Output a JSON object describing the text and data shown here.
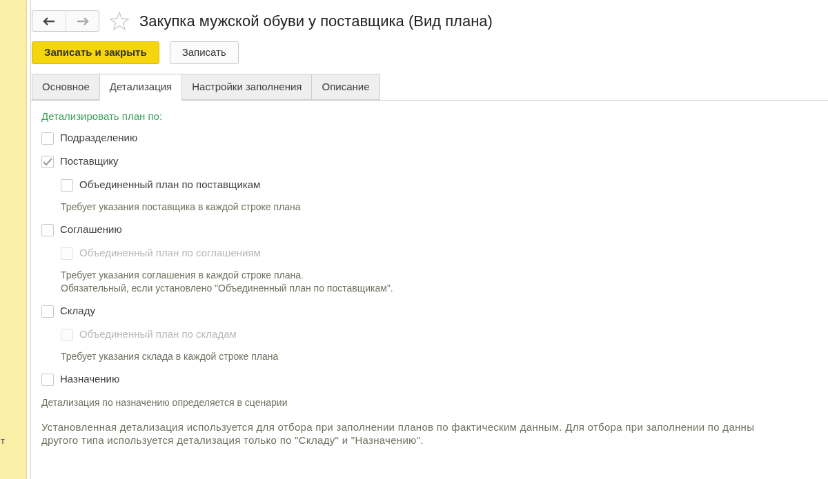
{
  "sidebar": {
    "text": "т"
  },
  "window": {
    "title": "Закупка мужской обуви у поставщика (Вид плана)"
  },
  "buttons": [
    {
      "label": "Записать и закрыть",
      "kind": "primary"
    },
    {
      "label": "Записать",
      "kind": "default"
    }
  ],
  "tabs": [
    {
      "label": "Основное",
      "selected": false
    },
    {
      "label": "Детализация",
      "selected": true
    },
    {
      "label": "Настройки заполнения",
      "selected": false
    },
    {
      "label": "Описание",
      "selected": false
    }
  ],
  "section": {
    "heading": "Детализировать план по:"
  },
  "items": [
    {
      "kind": "checkbox",
      "label": "Подразделению",
      "checked": false,
      "disabled": false
    },
    {
      "kind": "checkbox",
      "label": "Поставщику",
      "checked": true,
      "disabled": false,
      "children": [
        {
          "kind": "checkbox",
          "label": "Объединенный план по поставщикам",
          "checked": false,
          "disabled": false
        },
        {
          "kind": "note",
          "lines": [
            "Требует указания поставщика в каждой строке плана"
          ]
        }
      ]
    },
    {
      "kind": "checkbox",
      "label": "Соглашению",
      "checked": false,
      "disabled": false,
      "children": [
        {
          "kind": "checkbox",
          "label": "Объединенный план по соглашениям",
          "checked": false,
          "disabled": true
        },
        {
          "kind": "note",
          "lines": [
            "Требует указания соглашения в каждой строке плана.",
            "Обязательный, если установлено \"Объединенный план по поставщикам\"."
          ]
        }
      ]
    },
    {
      "kind": "checkbox",
      "label": "Складу",
      "checked": false,
      "disabled": false,
      "children": [
        {
          "kind": "checkbox",
          "label": "Объединенный план по складам",
          "checked": false,
          "disabled": true
        },
        {
          "kind": "note",
          "lines": [
            "Требует указания склада в каждой строке плана"
          ]
        }
      ]
    },
    {
      "kind": "checkbox",
      "label": "Назначению",
      "checked": false,
      "disabled": false
    },
    {
      "kind": "note",
      "lines": [
        "Детализация по назначению определяется в сценарии"
      ]
    }
  ],
  "footer_note": {
    "lines": [
      "Установленная детализация используется для отбора при заполнении планов по фактическим данным. Для отбора при заполнении по данны",
      "другого типа используется детализация только по \"Складу\" и \"Назначению\"."
    ]
  }
}
